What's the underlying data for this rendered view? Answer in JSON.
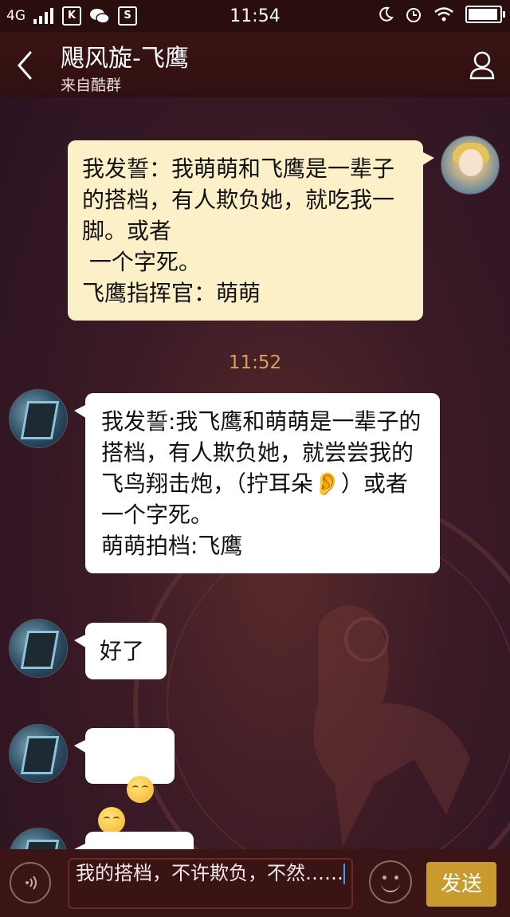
{
  "status_bar": {
    "network": "4G",
    "time": "11:54",
    "app_icons": [
      "k-icon",
      "wechat-icon",
      "s-icon"
    ],
    "right_icons": [
      "moon-icon",
      "alarm-icon",
      "wifi-icon",
      "battery-icon"
    ],
    "battery_level": 0.95
  },
  "header": {
    "title": "飓风旋-飞鹰",
    "subtitle": "来自酷群"
  },
  "messages": [
    {
      "side": "out",
      "text": "我发誓：我萌萌和飞鹰是一辈子的搭档，有人欺负她，就吃我一脚。或者\n 一个字死。\n飞鹰指挥官：萌萌"
    },
    {
      "side": "in",
      "text": "我发誓:我飞鹰和萌萌是一辈子的搭档，有人欺负她，就尝尝我的飞鸟翔击炮，（拧耳朵👂）或者一个字死。\n萌萌拍档:飞鹰"
    },
    {
      "side": "in",
      "text": "好了"
    },
    {
      "side": "in",
      "text": ""
    },
    {
      "side": "in",
      "text": ""
    }
  ],
  "timestamp": "11:52",
  "input": {
    "value": "我的搭档，不许欺负，不然……",
    "send_label": "发送"
  },
  "colors": {
    "header_bg": "#2f1010",
    "outgoing_bubble": "#fbf0c8",
    "incoming_bubble": "#ffffff",
    "timestamp": "#d7a25c",
    "send_button": "#c99a2e"
  }
}
